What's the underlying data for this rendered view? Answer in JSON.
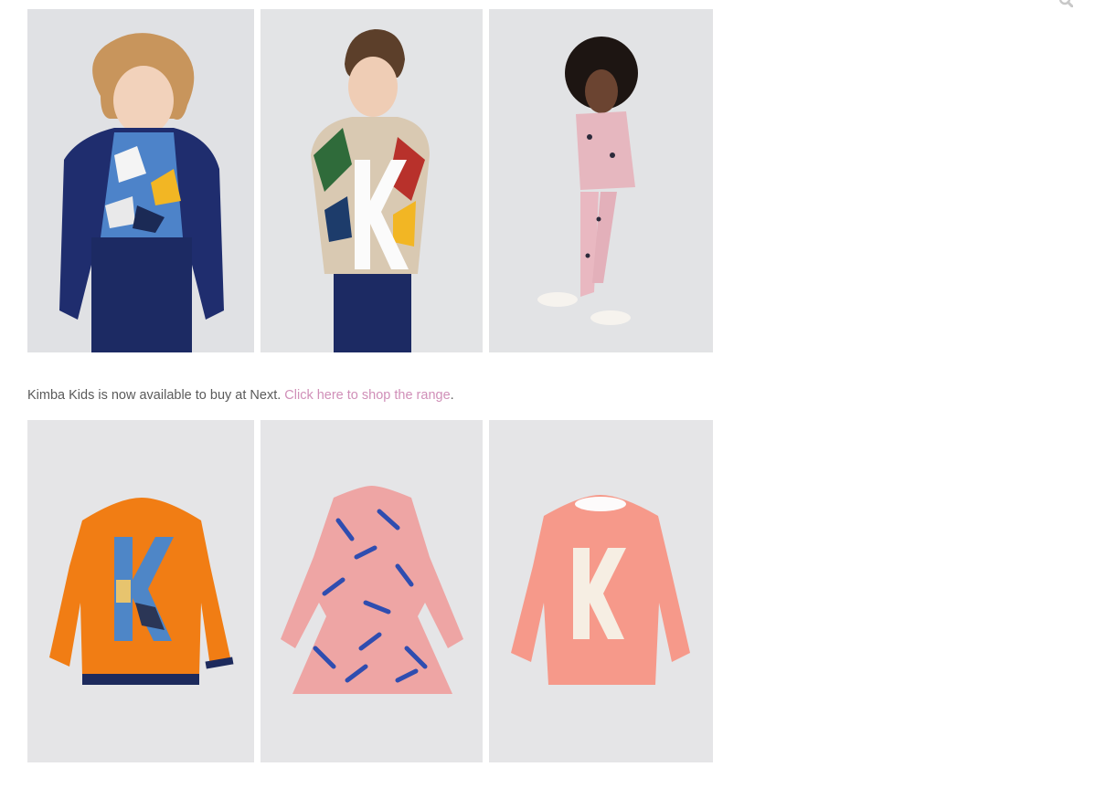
{
  "header": {
    "search_icon": "search-icon"
  },
  "caption": {
    "lead": "Kimba Kids is now available to buy at Next. ",
    "link": "Click here to shop the range",
    "tail": "."
  },
  "colors": {
    "link": "#d08fb8",
    "body_text": "#5a5a5a",
    "studio_bg": "#e4e4e6",
    "orange": "#f07d14",
    "salmon": "#f6998a",
    "navy": "#1d2a5c"
  }
}
